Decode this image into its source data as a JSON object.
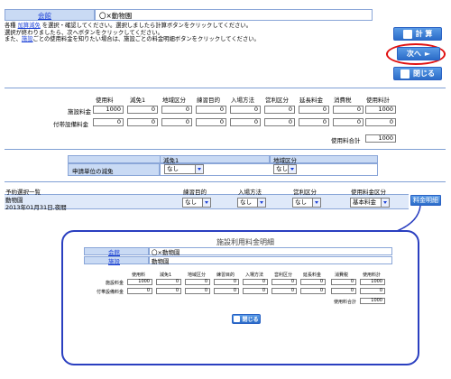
{
  "header": {
    "facility_link": "会館",
    "facility_name": "〇×動物園"
  },
  "instructions": {
    "line1_pre": "各種 ",
    "line1_link": "加算減免",
    "line1_post": " を選択・確認してください。選択しましたら計算ボタンをクリックしてください。",
    "line2": "選択が終わりましたら、次へボタンをクリックしてください。",
    "line3_pre": "また、",
    "line3_link": "施設",
    "line3_post": "ごとの使用料金を知りたい場合は、施設ごとの料金明細ボタンをクリックしてください。"
  },
  "buttons": {
    "calc": "計 算",
    "next": "次へ",
    "close": "閉じる",
    "fee_detail": "料金明細",
    "popup_close": "閉じる"
  },
  "fees": {
    "columns": [
      "使用料",
      "減免1",
      "地域区分",
      "練習目的",
      "入場方法",
      "営利区分",
      "延長料金",
      "消費税",
      "使用料計"
    ],
    "rows": [
      {
        "label": "施設料金",
        "values": [
          "1000",
          "0",
          "0",
          "0",
          "0",
          "0",
          "0",
          "0",
          "1000"
        ]
      },
      {
        "label": "付帯設備料金",
        "values": [
          "0",
          "0",
          "0",
          "0",
          "0",
          "0",
          "0",
          "0",
          "0"
        ]
      }
    ],
    "total_label": "使用料合計",
    "total_value": "1000"
  },
  "discount": {
    "col1": "減免1",
    "col2": "地域区分",
    "row_label": "申請単位の減免",
    "sel1": "なし",
    "sel2": "なし"
  },
  "reservations": {
    "title": "予約選択一覧",
    "columns": [
      "練習目的",
      "入場方法",
      "営利区分",
      "使用料金区分"
    ],
    "item_name": "動物園",
    "item_date": "2013年01月31日,夜間",
    "sel_practice": "なし",
    "sel_entry": "なし",
    "sel_profit": "なし",
    "sel_rate": "基本料金"
  },
  "popup": {
    "title": "施設利用料金明細",
    "facility_link": "会館",
    "facility_name": "〇×動物園",
    "room_link": "施設",
    "room_name": "動物園",
    "columns": [
      "使用料",
      "減免1",
      "地域区分",
      "練習目的",
      "入場方法",
      "営利区分",
      "延長料金",
      "消費税",
      "使用料計"
    ],
    "rows": [
      {
        "label": "施設料金",
        "values": [
          "1000",
          "0",
          "0",
          "0",
          "0",
          "0",
          "0",
          "0",
          "1000"
        ]
      },
      {
        "label": "付帯設備料金",
        "values": [
          "0",
          "0",
          "0",
          "0",
          "0",
          "0",
          "0",
          "0",
          "0"
        ]
      }
    ],
    "total_label": "使用料合計",
    "total_value": "1000"
  },
  "colors": {
    "accent": "#2b6cc8",
    "highlight_ring": "#e01010",
    "popup_border": "#2a3fc0",
    "header_fill": "#c9daf4"
  }
}
